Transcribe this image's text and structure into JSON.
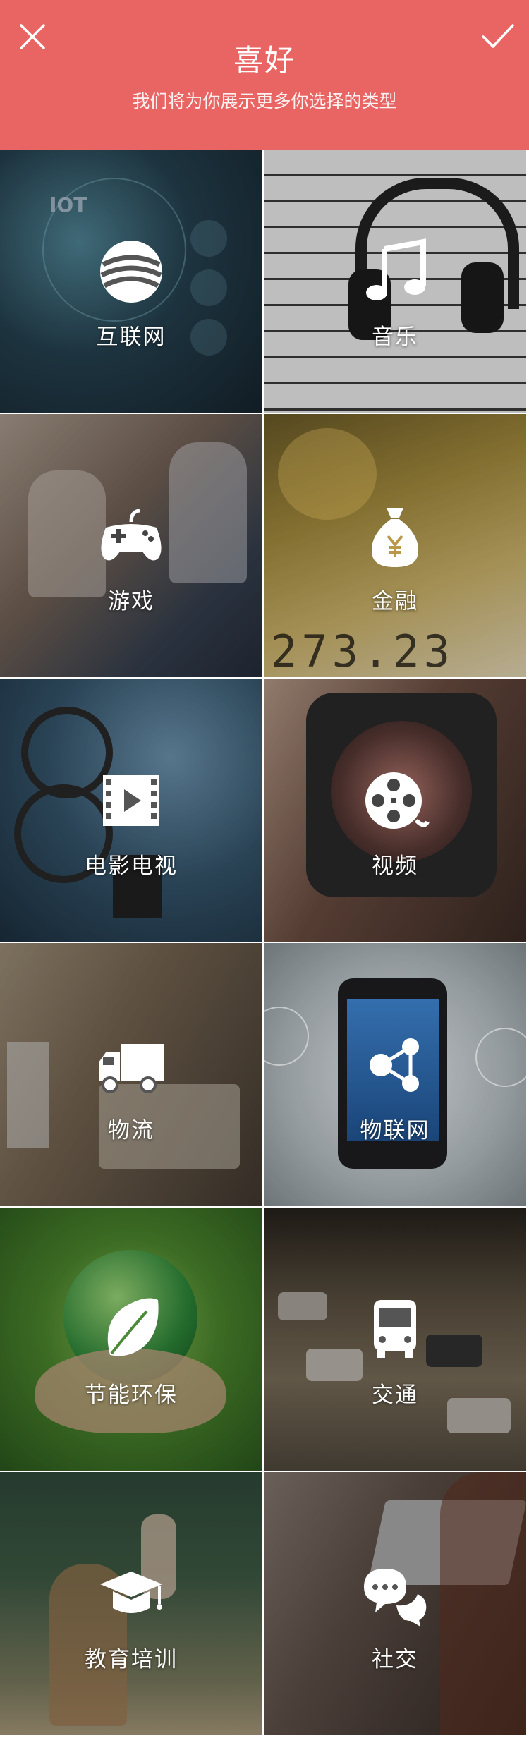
{
  "header": {
    "title": "喜好",
    "subtitle": "我们将为你展示更多你选择的类型",
    "close_icon": "close-icon",
    "confirm_icon": "check-icon",
    "background": "#e86563"
  },
  "categories": [
    {
      "label": "互联网",
      "icon": "internet-globe-icon"
    },
    {
      "label": "音乐",
      "icon": "music-note-icon"
    },
    {
      "label": "游戏",
      "icon": "gamepad-icon"
    },
    {
      "label": "金融",
      "icon": "money-bag-yen-icon"
    },
    {
      "label": "电影电视",
      "icon": "film-play-icon"
    },
    {
      "label": "视频",
      "icon": "film-reel-icon"
    },
    {
      "label": "物流",
      "icon": "delivery-truck-icon"
    },
    {
      "label": "物联网",
      "icon": "network-nodes-icon"
    },
    {
      "label": "节能环保",
      "icon": "leaf-icon"
    },
    {
      "label": "交通",
      "icon": "bus-icon"
    },
    {
      "label": "教育培训",
      "icon": "graduation-cap-icon"
    },
    {
      "label": "社交",
      "icon": "chat-bubbles-icon"
    }
  ],
  "decor": {
    "iot_text": "IOT",
    "finance_number": "273.23"
  }
}
